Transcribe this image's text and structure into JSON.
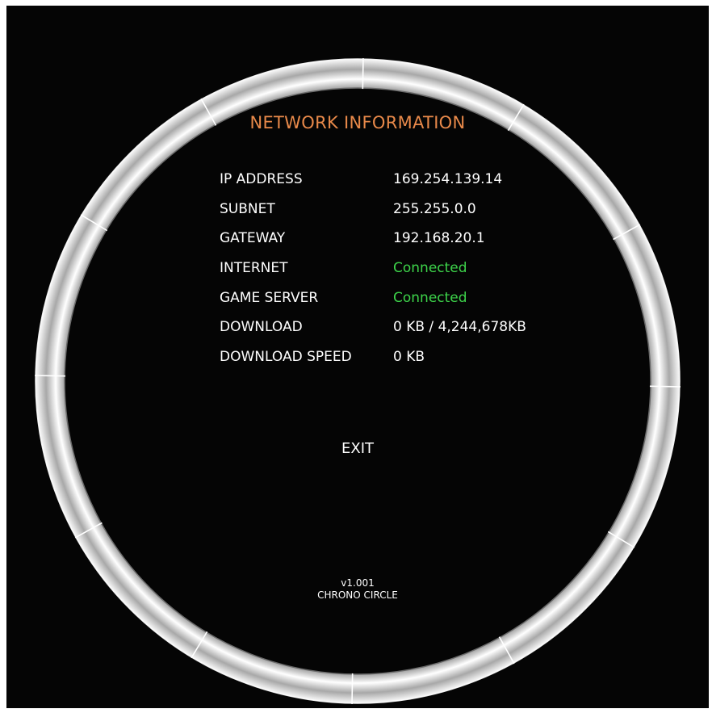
{
  "screen": {
    "title": "NETWORK INFORMATION",
    "title_color": "#e8894a",
    "status_color": "#3dd34a",
    "background": "#050505"
  },
  "rows": [
    {
      "label": "IP ADDRESS",
      "value": "169.254.139.14",
      "status": false
    },
    {
      "label": "SUBNET",
      "value": "255.255.0.0",
      "status": false
    },
    {
      "label": "GATEWAY",
      "value": "192.168.20.1",
      "status": false
    },
    {
      "label": "INTERNET",
      "value": "Connected",
      "status": true
    },
    {
      "label": "GAME SERVER",
      "value": "Connected",
      "status": true
    },
    {
      "label": "DOWNLOAD",
      "value": "0 KB / 4,244,678KB",
      "status": false
    },
    {
      "label": "DOWNLOAD SPEED",
      "value": "0 KB",
      "status": false
    }
  ],
  "exit_label": "EXIT",
  "footer": {
    "version": "v1.001",
    "product": "CHRONO CIRCLE"
  },
  "ring": {
    "segments": 12,
    "icon": "ring-frame"
  }
}
